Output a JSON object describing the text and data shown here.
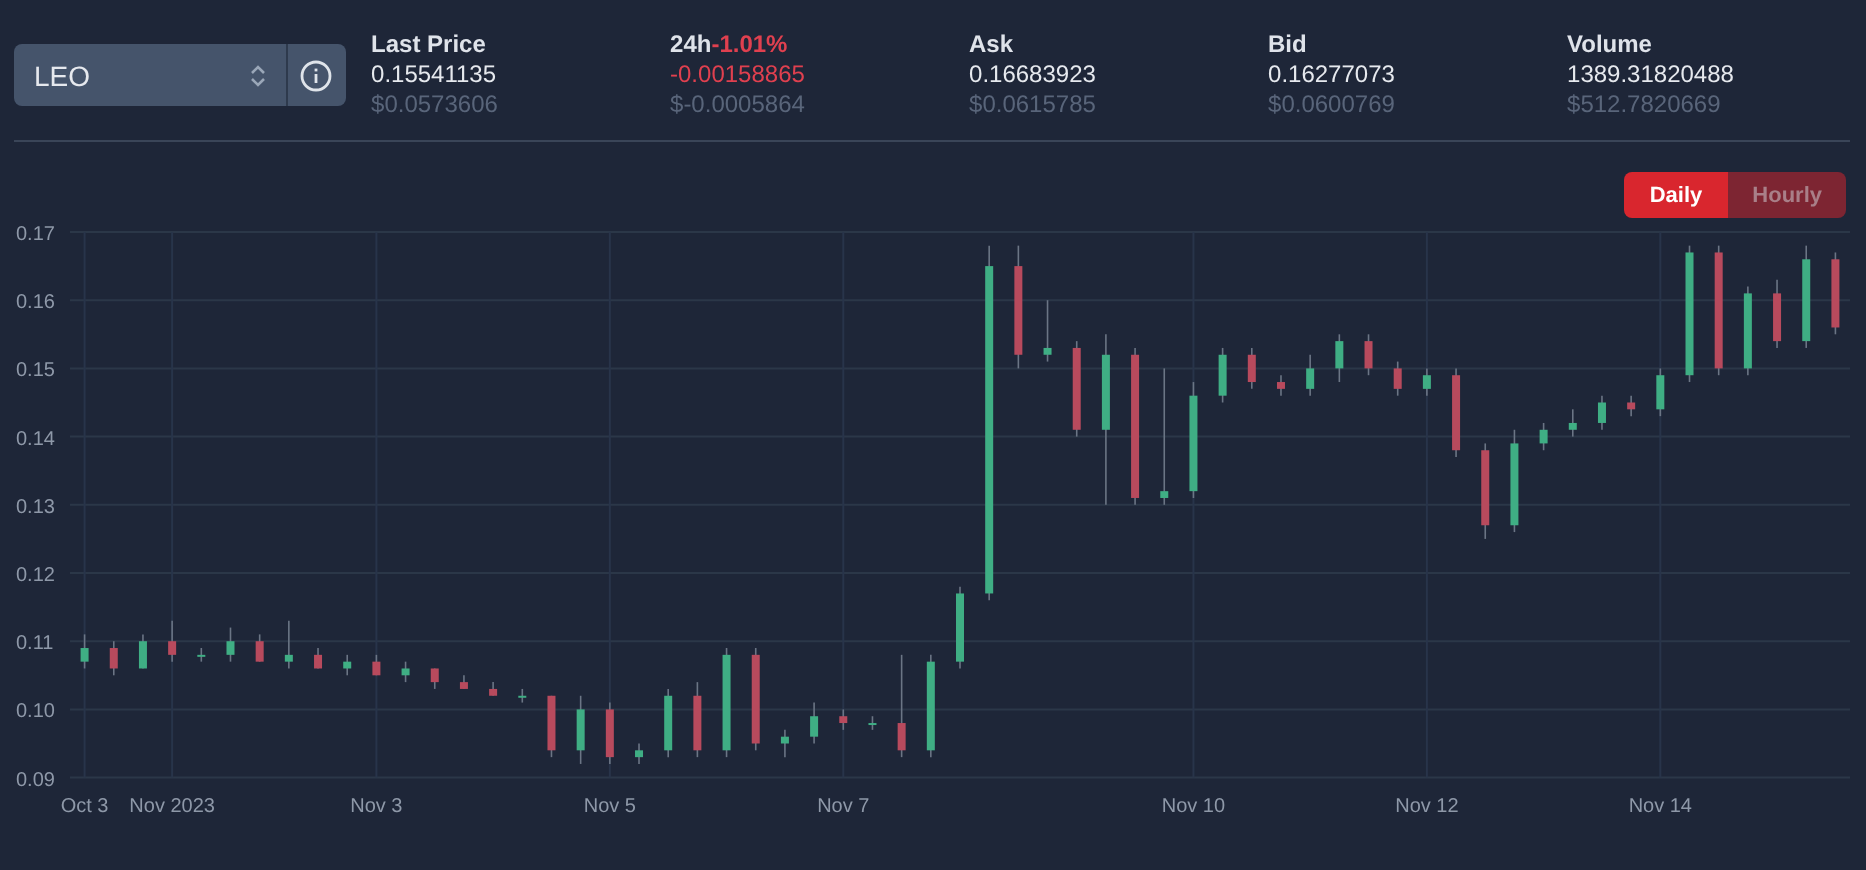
{
  "market_select": {
    "value": "LEO"
  },
  "stats": [
    {
      "kind": "plain",
      "label": "Last Price",
      "value": "0.15541135",
      "usd": "$0.0573606"
    },
    {
      "kind": "change",
      "label": "24h",
      "change": "-1.01%",
      "value": "-0.00158865",
      "usd": "$-0.0005864"
    },
    {
      "kind": "plain",
      "label": "Ask",
      "value": "0.16683923",
      "usd": "$0.0615785"
    },
    {
      "kind": "plain",
      "label": "Bid",
      "value": "0.16277073",
      "usd": "$0.0600769"
    },
    {
      "kind": "plain",
      "label": "Volume",
      "value": "1389.31820488",
      "usd": "$512.7820669"
    }
  ],
  "interval_tabs": [
    {
      "label": "Daily",
      "selected": true
    },
    {
      "label": "Hourly",
      "selected": false
    }
  ],
  "chart": {
    "chart_data": {
      "type": "candlestick",
      "categories": [
        "Oct 3",
        null,
        null,
        "Nov 2023",
        null,
        null,
        null,
        null,
        null,
        null,
        "Nov 3",
        null,
        null,
        null,
        null,
        null,
        null,
        null,
        "Nov 5",
        null,
        null,
        null,
        null,
        null,
        null,
        null,
        "Nov 7",
        null,
        null,
        null,
        null,
        null,
        null,
        null,
        null,
        null,
        null,
        null,
        "Nov 10",
        null,
        null,
        null,
        null,
        null,
        null,
        null,
        "Nov 12",
        null,
        null,
        null,
        null,
        null,
        null,
        null,
        "Nov 14",
        null,
        null,
        null,
        null,
        null,
        null
      ],
      "ohlc": [
        [
          0.107,
          0.111,
          0.106,
          0.109
        ],
        [
          0.109,
          0.11,
          0.105,
          0.106
        ],
        [
          0.106,
          0.111,
          0.106,
          0.11
        ],
        [
          0.11,
          0.113,
          0.107,
          0.108
        ],
        [
          0.108,
          0.109,
          0.107,
          0.108
        ],
        [
          0.108,
          0.112,
          0.107,
          0.11
        ],
        [
          0.11,
          0.111,
          0.107,
          0.107
        ],
        [
          0.107,
          0.113,
          0.106,
          0.108
        ],
        [
          0.108,
          0.109,
          0.106,
          0.106
        ],
        [
          0.106,
          0.108,
          0.105,
          0.107
        ],
        [
          0.107,
          0.108,
          0.105,
          0.105
        ],
        [
          0.105,
          0.107,
          0.104,
          0.106
        ],
        [
          0.106,
          0.106,
          0.103,
          0.104
        ],
        [
          0.104,
          0.105,
          0.103,
          0.103
        ],
        [
          0.103,
          0.104,
          0.102,
          0.102
        ],
        [
          0.102,
          0.103,
          0.101,
          0.102
        ],
        [
          0.102,
          0.102,
          0.093,
          0.094
        ],
        [
          0.094,
          0.102,
          0.092,
          0.1
        ],
        [
          0.1,
          0.101,
          0.092,
          0.093
        ],
        [
          0.093,
          0.095,
          0.092,
          0.094
        ],
        [
          0.094,
          0.103,
          0.093,
          0.102
        ],
        [
          0.102,
          0.104,
          0.093,
          0.094
        ],
        [
          0.094,
          0.109,
          0.093,
          0.108
        ],
        [
          0.108,
          0.109,
          0.094,
          0.095
        ],
        [
          0.095,
          0.097,
          0.093,
          0.096
        ],
        [
          0.096,
          0.101,
          0.095,
          0.099
        ],
        [
          0.099,
          0.1,
          0.097,
          0.098
        ],
        [
          0.098,
          0.099,
          0.097,
          0.098
        ],
        [
          0.098,
          0.108,
          0.093,
          0.094
        ],
        [
          0.094,
          0.108,
          0.093,
          0.107
        ],
        [
          0.107,
          0.118,
          0.106,
          0.117
        ],
        [
          0.117,
          0.168,
          0.116,
          0.165
        ],
        [
          0.165,
          0.168,
          0.15,
          0.152
        ],
        [
          0.152,
          0.16,
          0.151,
          0.153
        ],
        [
          0.153,
          0.154,
          0.14,
          0.141
        ],
        [
          0.141,
          0.155,
          0.13,
          0.152
        ],
        [
          0.152,
          0.153,
          0.13,
          0.131
        ],
        [
          0.131,
          0.15,
          0.13,
          0.132
        ],
        [
          0.132,
          0.148,
          0.131,
          0.146
        ],
        [
          0.146,
          0.153,
          0.145,
          0.152
        ],
        [
          0.152,
          0.153,
          0.147,
          0.148
        ],
        [
          0.148,
          0.149,
          0.146,
          0.147
        ],
        [
          0.147,
          0.152,
          0.146,
          0.15
        ],
        [
          0.15,
          0.155,
          0.148,
          0.154
        ],
        [
          0.154,
          0.155,
          0.149,
          0.15
        ],
        [
          0.15,
          0.151,
          0.146,
          0.147
        ],
        [
          0.147,
          0.15,
          0.146,
          0.149
        ],
        [
          0.149,
          0.15,
          0.137,
          0.138
        ],
        [
          0.138,
          0.139,
          0.125,
          0.127
        ],
        [
          0.127,
          0.141,
          0.126,
          0.139
        ],
        [
          0.139,
          0.142,
          0.138,
          0.141
        ],
        [
          0.141,
          0.144,
          0.14,
          0.142
        ],
        [
          0.142,
          0.146,
          0.141,
          0.145
        ],
        [
          0.145,
          0.146,
          0.143,
          0.144
        ],
        [
          0.144,
          0.15,
          0.143,
          0.149
        ],
        [
          0.149,
          0.168,
          0.148,
          0.167
        ],
        [
          0.167,
          0.168,
          0.149,
          0.15
        ],
        [
          0.15,
          0.162,
          0.149,
          0.161
        ],
        [
          0.161,
          0.163,
          0.153,
          0.154
        ],
        [
          0.154,
          0.168,
          0.153,
          0.166
        ],
        [
          0.166,
          0.167,
          0.155,
          0.156
        ]
      ],
      "ylim": [
        0.09,
        0.17
      ],
      "grid": true,
      "yticks": [
        {
          "value": 0.17,
          "label": "0.17"
        },
        {
          "value": 0.16,
          "label": "0.16"
        },
        {
          "value": 0.15,
          "label": "0.15"
        },
        {
          "value": 0.14,
          "label": "0.14"
        },
        {
          "value": 0.13,
          "label": "0.13"
        },
        {
          "value": 0.12,
          "label": "0.12"
        },
        {
          "value": 0.11,
          "label": "0.11"
        },
        {
          "value": 0.1,
          "label": "0.10"
        },
        {
          "value": 0.09,
          "label": "0.09"
        }
      ]
    }
  }
}
